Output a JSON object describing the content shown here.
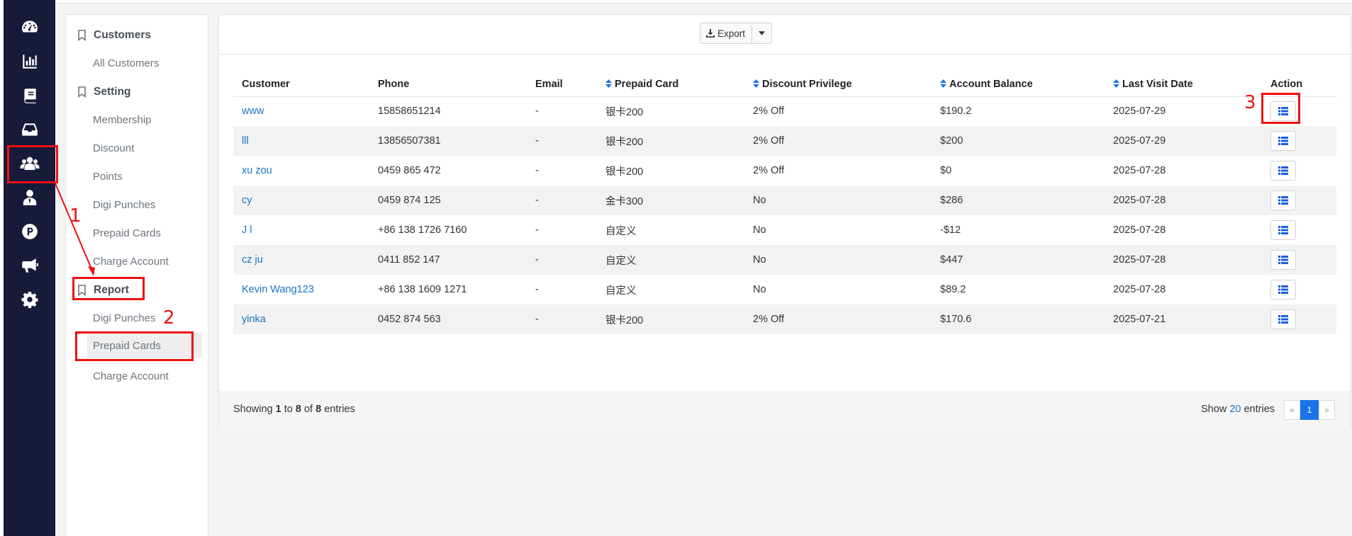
{
  "submenu": {
    "customers_header": "Customers",
    "all_customers": "All Customers",
    "setting_header": "Setting",
    "membership": "Membership",
    "discount": "Discount",
    "points": "Points",
    "digi_punches": "Digi Punches",
    "prepaid_cards": "Prepaid Cards",
    "charge_account": "Charge Account",
    "report_header": "Report",
    "report_digi_punches": "Digi Punches",
    "report_prepaid_cards": "Prepaid Cards",
    "report_charge_account": "Charge Account"
  },
  "toolbar": {
    "export_label": "Export"
  },
  "table": {
    "headers": {
      "customer": "Customer",
      "phone": "Phone",
      "email": "Email",
      "prepaid_card": "Prepaid Card",
      "discount_privilege": "Discount Privilege",
      "account_balance": "Account Balance",
      "last_visit_date": "Last Visit Date",
      "action": "Action"
    },
    "rows": [
      {
        "customer": "www",
        "phone": "15858651214",
        "email": "-",
        "prepaid_card": "银卡200",
        "discount": "2% Off",
        "balance": "$190.2",
        "last_visit": "2025-07-29"
      },
      {
        "customer": "lll",
        "phone": "13856507381",
        "email": "-",
        "prepaid_card": "银卡200",
        "discount": "2% Off",
        "balance": "$200",
        "last_visit": "2025-07-29"
      },
      {
        "customer": "xu zou",
        "phone": "0459 865 472",
        "email": "-",
        "prepaid_card": "银卡200",
        "discount": "2% Off",
        "balance": "$0",
        "last_visit": "2025-07-28"
      },
      {
        "customer": "cy",
        "phone": "0459 874 125",
        "email": "-",
        "prepaid_card": "金卡300",
        "discount": "No",
        "balance": "$286",
        "last_visit": "2025-07-28"
      },
      {
        "customer": "J l",
        "phone": "+86 138 1726 7160",
        "email": "-",
        "prepaid_card": "自定义",
        "discount": "No",
        "balance": "-$12",
        "last_visit": "2025-07-28"
      },
      {
        "customer": "cz ju",
        "phone": "0411 852 147",
        "email": "-",
        "prepaid_card": "自定义",
        "discount": "No",
        "balance": "$447",
        "last_visit": "2025-07-28"
      },
      {
        "customer": "Kevin Wang123",
        "phone": "+86 138 1609 1271",
        "email": "-",
        "prepaid_card": "自定义",
        "discount": "No",
        "balance": "$89.2",
        "last_visit": "2025-07-28"
      },
      {
        "customer": "yinka",
        "phone": "0452 874 563",
        "email": "-",
        "prepaid_card": "银卡200",
        "discount": "2% Off",
        "balance": "$170.6",
        "last_visit": "2025-07-21"
      }
    ]
  },
  "footer": {
    "showing_prefix": "Showing ",
    "from": "1",
    "to_word": " to ",
    "to": "8",
    "of_word": " of ",
    "total": "8",
    "entries_word": " entries",
    "show_label": "Show ",
    "page_size": "20",
    "show_suffix": " entries",
    "prev": "«",
    "current_page": "1",
    "next": "»"
  },
  "annotations": {
    "step1": "1",
    "step2": "2",
    "step3": "3"
  },
  "colors": {
    "rail_bg": "#181a3a",
    "link": "#1a73c8",
    "highlight": "#ee1111",
    "page_active": "#1a73e8"
  }
}
